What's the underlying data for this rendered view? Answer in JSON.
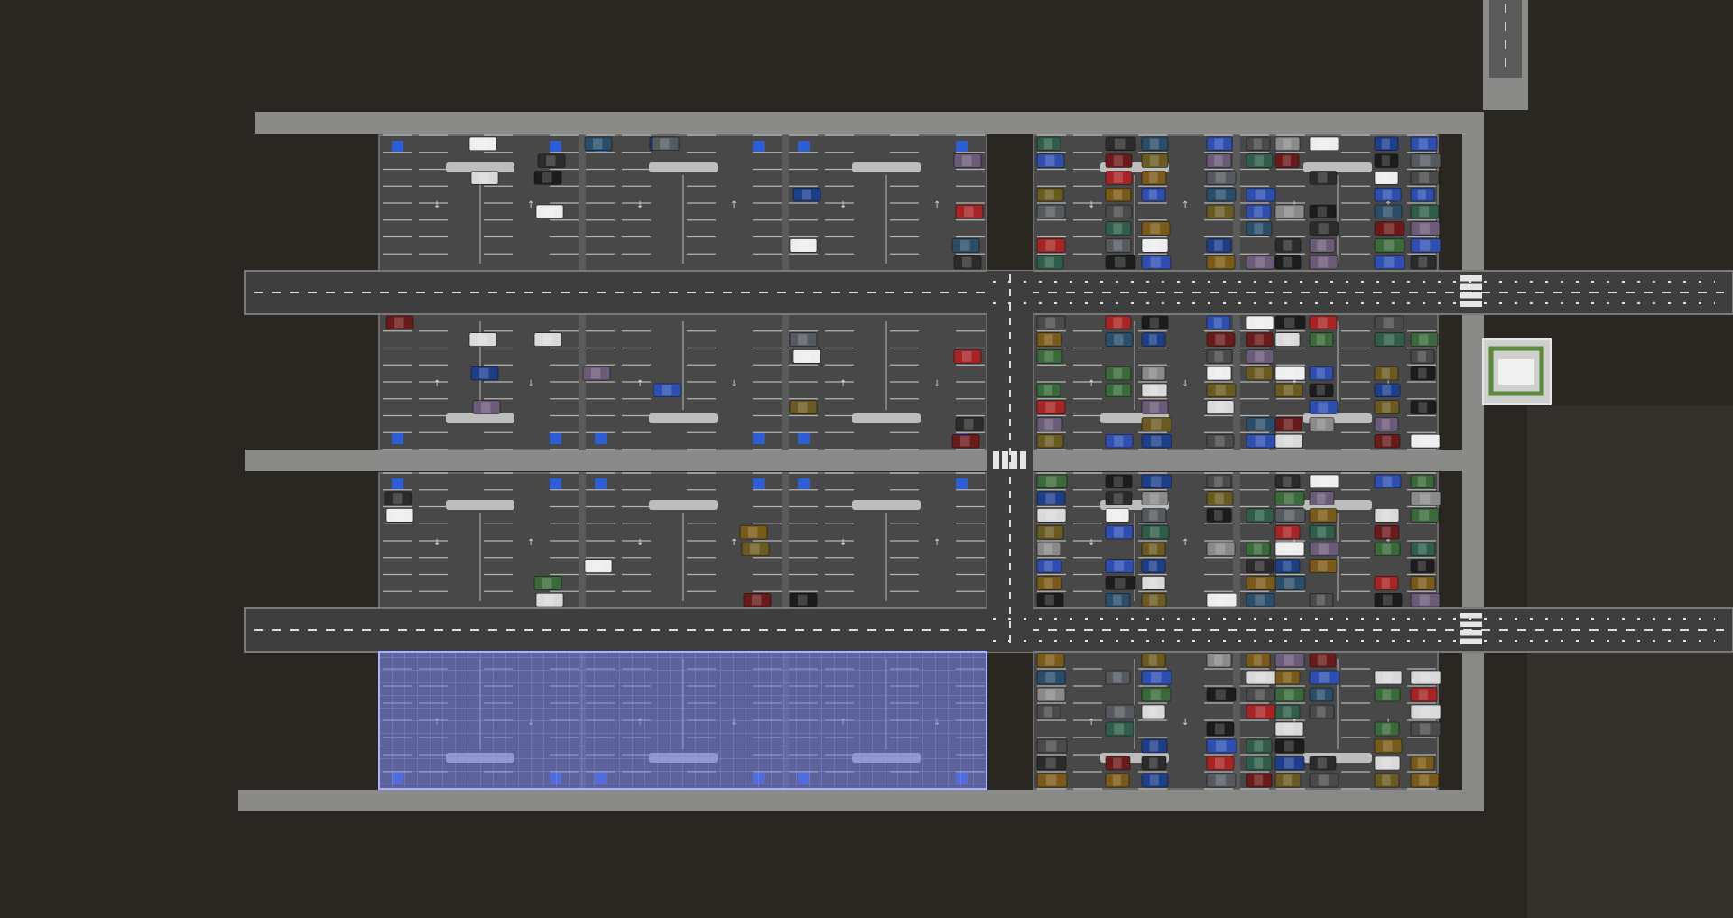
{
  "view": {
    "mode": "top-down parking lot builder",
    "colors": {
      "ground": "#2a2622",
      "ground_patch": "#34302c",
      "curb": "#8a8a88",
      "road": "#3e3e3e",
      "lot": "#484848",
      "line": "#cfcfcf",
      "arrow": "#d8d8d8",
      "handicap": "#2a5fd6",
      "placement_overlay": "#6f78e0",
      "kiosk_green": "#5c8a3a"
    }
  },
  "lots": {
    "west_top": {
      "kind": "empty-stalls",
      "handicap_icons": 6
    },
    "west_row2": {
      "kind": "empty-stalls",
      "handicap_icons": 6
    },
    "west_row3": {
      "kind": "empty-stalls",
      "handicap_icons": 6
    },
    "west_bottom": {
      "kind": "placement-preview",
      "handicap_icons": 6
    },
    "east_top": {
      "kind": "filled"
    },
    "east_row2": {
      "kind": "filled"
    },
    "east_row3": {
      "kind": "filled"
    },
    "east_bottom": {
      "kind": "filled"
    }
  },
  "car_palette": [
    "#2b2b2b",
    "#1c1c1c",
    "#6b1a1a",
    "#a82424",
    "#d9d9d9",
    "#eeeeee",
    "#1d3f8a",
    "#2e4fb0",
    "#3a6a3a",
    "#2f5d4a",
    "#6a5a20",
    "#7a5a18",
    "#6b5a78",
    "#555a60",
    "#8a8a8a",
    "#2a4d6a",
    "#4a4a4a"
  ],
  "parked_cars_west": [
    {
      "lot": "west_top",
      "col": 1,
      "row": 0,
      "c": 5
    },
    {
      "lot": "west_top",
      "col": 1,
      "row": 2,
      "c": 4
    },
    {
      "lot": "west_top",
      "col": 2,
      "row": 1,
      "c": 0
    },
    {
      "lot": "west_top",
      "col": 2,
      "row": 2,
      "c": 1
    },
    {
      "lot": "west_top",
      "col": 2,
      "row": 4,
      "c": 5
    },
    {
      "lot": "west_top",
      "col": 3,
      "row": 0,
      "c": 15
    },
    {
      "lot": "west_top",
      "col": 4,
      "row": 0,
      "c": 6
    },
    {
      "lot": "west_top",
      "col": 4,
      "row": 0,
      "c": 13
    },
    {
      "lot": "west_top",
      "col": 6,
      "row": 3,
      "c": 6
    },
    {
      "lot": "west_top",
      "col": 6,
      "row": 6,
      "c": 5
    },
    {
      "lot": "west_top",
      "col": 7,
      "row": 1,
      "c": 12
    },
    {
      "lot": "west_top",
      "col": 7,
      "row": 4,
      "c": 3
    },
    {
      "lot": "west_top",
      "col": 7,
      "row": 6,
      "c": 15
    },
    {
      "lot": "west_top",
      "col": 7,
      "row": 7,
      "c": 0
    },
    {
      "lot": "west_row2",
      "col": 0,
      "row": 0,
      "c": 2
    },
    {
      "lot": "west_row2",
      "col": 1,
      "row": 1,
      "c": 4
    },
    {
      "lot": "west_row2",
      "col": 1,
      "row": 3,
      "c": 6
    },
    {
      "lot": "west_row2",
      "col": 1,
      "row": 5,
      "c": 12
    },
    {
      "lot": "west_row2",
      "col": 2,
      "row": 1,
      "c": 4
    },
    {
      "lot": "west_row2",
      "col": 3,
      "row": 3,
      "c": 12
    },
    {
      "lot": "west_row2",
      "col": 4,
      "row": 4,
      "c": 7
    },
    {
      "lot": "west_row2",
      "col": 6,
      "row": 1,
      "c": 13
    },
    {
      "lot": "west_row2",
      "col": 6,
      "row": 2,
      "c": 13
    },
    {
      "lot": "west_row2",
      "col": 6,
      "row": 2,
      "c": 5
    },
    {
      "lot": "west_row2",
      "col": 6,
      "row": 5,
      "c": 10
    },
    {
      "lot": "west_row2",
      "col": 7,
      "row": 2,
      "c": 3
    },
    {
      "lot": "west_row2",
      "col": 7,
      "row": 6,
      "c": 0
    },
    {
      "lot": "west_row2",
      "col": 7,
      "row": 7,
      "c": 2
    },
    {
      "lot": "west_row3",
      "col": 0,
      "row": 1,
      "c": 0
    },
    {
      "lot": "west_row3",
      "col": 0,
      "row": 2,
      "c": 5
    },
    {
      "lot": "west_row3",
      "col": 2,
      "row": 6,
      "c": 8
    },
    {
      "lot": "west_row3",
      "col": 2,
      "row": 7,
      "c": 4
    },
    {
      "lot": "west_row3",
      "col": 3,
      "row": 5,
      "c": 5
    },
    {
      "lot": "west_row3",
      "col": 5,
      "row": 3,
      "c": 11
    },
    {
      "lot": "west_row3",
      "col": 5,
      "row": 4,
      "c": 10
    },
    {
      "lot": "west_row3",
      "col": 5,
      "row": 7,
      "c": 2
    },
    {
      "lot": "west_row3",
      "col": 6,
      "row": 7,
      "c": 1
    }
  ],
  "facilities": {
    "ticket_booth": {
      "kind": "kiosk"
    },
    "north_entrance": {
      "kind": "ramp"
    }
  }
}
